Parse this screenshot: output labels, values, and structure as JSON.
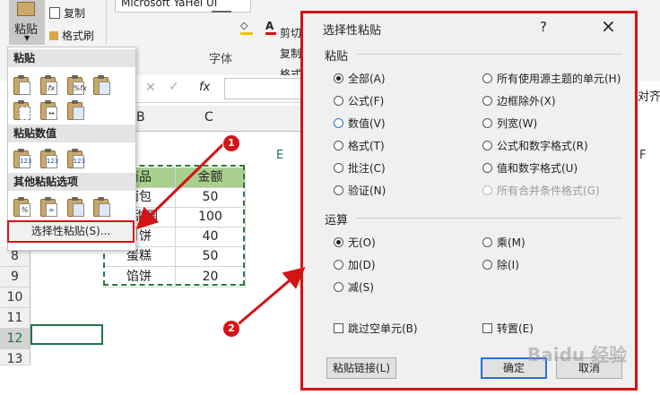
{
  "ribbon": {
    "paste_label": "粘贴",
    "copy_label": "复制",
    "format_painter_label": "格式刷",
    "font_name": "Microsoft YaHei UI",
    "font_group_label": "字体",
    "cut_label": "剪切",
    "copy2_label": "复制",
    "format_painter2_label": "格式刷",
    "align_right_label": "对齐",
    "fx_label": "fx"
  },
  "paste_menu": {
    "section_paste": "粘贴",
    "section_values": "粘贴数值",
    "section_other": "其他粘贴选项",
    "paste_special": "选择性粘贴(S)...",
    "icons_row1": [
      "",
      "fx",
      "%fx",
      ""
    ],
    "icons_row2": [
      "",
      "",
      ""
    ],
    "icons_values": [
      "123",
      "123",
      "123"
    ],
    "icons_other": [
      "%",
      "",
      "",
      ""
    ]
  },
  "sheet": {
    "col_b": "B",
    "col_c": "C",
    "col_e": "E",
    "col_f": "F",
    "header_item": "商品",
    "header_amount": "金额",
    "rows": [
      {
        "num": "",
        "item": "面包",
        "amount": "50"
      },
      {
        "num": "",
        "item": "甜甜圈",
        "amount": "100"
      },
      {
        "num": "",
        "item": "月饼",
        "amount": "40"
      },
      {
        "num": "8",
        "item": "蛋糕",
        "amount": "50"
      },
      {
        "num": "9",
        "item": "馅饼",
        "amount": "20"
      }
    ],
    "empty_rows": [
      "10",
      "11",
      "12",
      "13"
    ]
  },
  "dialog": {
    "title": "选择性粘贴",
    "help": "?",
    "close": "×",
    "paste_group": "粘贴",
    "paste_left": [
      "全部(A)",
      "公式(F)",
      "数值(V)",
      "格式(T)",
      "批注(C)",
      "验证(N)"
    ],
    "paste_right": [
      "所有使用源主题的单元(H)",
      "边框除外(X)",
      "列宽(W)",
      "公式和数字格式(R)",
      "值和数字格式(U)",
      "所有合并条件格式(G)"
    ],
    "op_group": "运算",
    "op_left": [
      "无(O)",
      "加(D)",
      "减(S)"
    ],
    "op_right": [
      "乘(M)",
      "除(I)"
    ],
    "skip_blanks": "跳过空单元(B)",
    "transpose": "转置(E)",
    "paste_link": "粘贴链接(L)",
    "ok": "确定",
    "cancel": "取消"
  },
  "badges": {
    "one": "1",
    "two": "2"
  },
  "watermark": "Baidu 经验",
  "colors": {
    "accent_red": "#d41414",
    "header_green": "#a9d08e",
    "excel_green": "#217346"
  }
}
